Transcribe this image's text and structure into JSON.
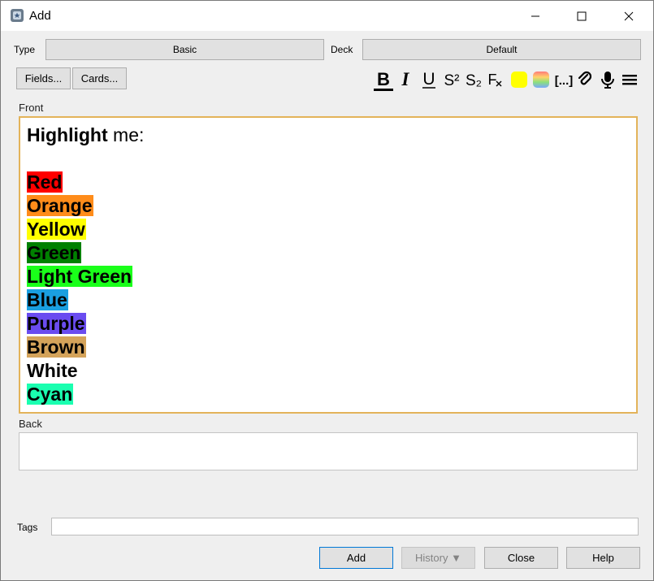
{
  "window": {
    "title": "Add"
  },
  "note_type": {
    "label": "Type",
    "value": "Basic"
  },
  "deck": {
    "label": "Deck",
    "value": "Default"
  },
  "buttons": {
    "fields": "Fields...",
    "cards": "Cards..."
  },
  "toolbar": {
    "bold": "B",
    "italic": "I",
    "underline": "U",
    "superscript": "S²",
    "subscript": "S₂",
    "clear_format": "F",
    "cloze": "[...]",
    "text_color": "#ffff00"
  },
  "front": {
    "label": "Front",
    "first_line_bold": "Highlight",
    "first_line_rest": " me:",
    "highlights": [
      {
        "text": "Red",
        "color": "#ff0000"
      },
      {
        "text": "Orange",
        "color": "#ff8c1a"
      },
      {
        "text": "Yellow",
        "color": "#ffff00"
      },
      {
        "text": "Green",
        "color": "#008000"
      },
      {
        "text": "Light Green",
        "color": "#1aff1a"
      },
      {
        "text": "Blue",
        "color": "#1a9fe0"
      },
      {
        "text": "Purple",
        "color": "#6a4cf0"
      },
      {
        "text": "Brown",
        "color": "#d4a35a"
      },
      {
        "text": "White",
        "color": "#ffffff"
      },
      {
        "text": "Cyan",
        "color": "#1affb0"
      }
    ]
  },
  "back": {
    "label": "Back",
    "value": ""
  },
  "tags": {
    "label": "Tags",
    "value": ""
  },
  "footer": {
    "add": "Add",
    "history": "History ▼",
    "close": "Close",
    "help": "Help"
  }
}
